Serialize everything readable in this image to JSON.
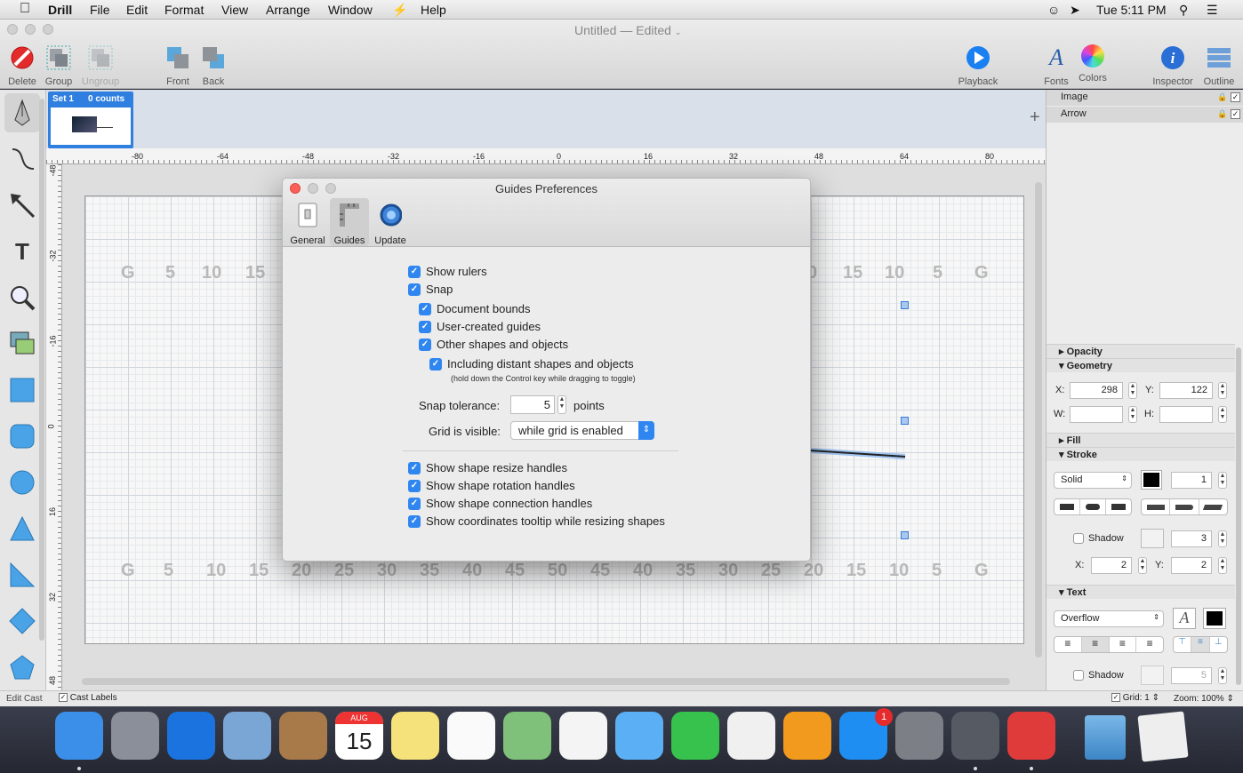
{
  "menubar": {
    "app": "Drill",
    "items": [
      "File",
      "Edit",
      "Format",
      "View",
      "Arrange",
      "Window",
      "Help"
    ],
    "clock": "Tue 5:11 PM"
  },
  "window": {
    "title": "Untitled",
    "subtitle": "— Edited",
    "toolbar_left": [
      {
        "label": "Delete",
        "icon": "delete-icon",
        "enabled": true
      },
      {
        "label": "Group",
        "icon": "group-icon",
        "enabled": true
      },
      {
        "label": "Ungroup",
        "icon": "ungroup-icon",
        "enabled": false
      },
      {
        "label": "Front",
        "icon": "front-icon",
        "enabled": true
      },
      {
        "label": "Back",
        "icon": "back-icon",
        "enabled": true
      }
    ],
    "toolbar_right": [
      {
        "label": "Playback",
        "icon": "playback-icon"
      },
      {
        "label": "Fonts",
        "icon": "fonts-icon"
      },
      {
        "label": "Colors",
        "icon": "colors-icon"
      },
      {
        "label": "Inspector",
        "icon": "inspector-icon"
      },
      {
        "label": "Outline",
        "icon": "outline-icon"
      }
    ]
  },
  "cast": {
    "set_label": "Set 1",
    "counts_label": "0 counts",
    "add_symbol": "+"
  },
  "rulers": {
    "top": [
      "-80",
      "-64",
      "-48",
      "-32",
      "-16",
      "0",
      "16",
      "32",
      "48",
      "64",
      "80"
    ],
    "left": [
      "-48",
      "-32",
      "-16",
      "0",
      "16",
      "32",
      "48"
    ]
  },
  "field_numbers": {
    "top_left": [
      "G",
      "5",
      "10",
      "15"
    ],
    "top_right": [
      "0",
      "15",
      "10",
      "5",
      "G"
    ],
    "bottom": [
      "G",
      "5",
      "10",
      "15",
      "20",
      "25",
      "30",
      "35",
      "40",
      "45",
      "50",
      "45",
      "40",
      "35",
      "30",
      "25",
      "20",
      "15",
      "10",
      "5",
      "G"
    ]
  },
  "layers": [
    {
      "name": "Image"
    },
    {
      "name": "Arrow"
    }
  ],
  "inspector": {
    "opacity": "Opacity",
    "geometry": "Geometry",
    "x_label": "X:",
    "x": "298",
    "y_label": "Y:",
    "y": "122",
    "w_label": "W:",
    "w": "",
    "h_label": "H:",
    "h": "",
    "fill": "Fill",
    "stroke": "Stroke",
    "stroke_style": "Solid",
    "stroke_width": "1",
    "shadow_label": "Shadow",
    "shadow_value": "3",
    "shadow_x_label": "X:",
    "shadow_x": "2",
    "shadow_y_label": "Y:",
    "shadow_y": "2",
    "text": "Text",
    "overflow": "Overflow",
    "text_shadow_label": "Shadow",
    "text_shadow_value": "5"
  },
  "statusbar": {
    "edit_cast": "Edit Cast",
    "cast_labels": "Cast Labels",
    "grid": "Grid: 1",
    "zoom": "Zoom: 100%"
  },
  "dialog": {
    "title": "Guides Preferences",
    "tabs": [
      {
        "label": "General",
        "icon": "general-switch-icon"
      },
      {
        "label": "Guides",
        "icon": "guides-ruler-icon"
      },
      {
        "label": "Update",
        "icon": "update-globe-icon"
      }
    ],
    "options1": [
      {
        "label": "Show rulers",
        "indent": 0
      },
      {
        "label": "Snap",
        "indent": 0
      },
      {
        "label": "Document bounds",
        "indent": 1
      },
      {
        "label": "User-created guides",
        "indent": 1
      },
      {
        "label": "Other shapes and objects",
        "indent": 1
      },
      {
        "label": "Including distant shapes and objects",
        "indent": 2
      }
    ],
    "hint": "(hold down the Control key while dragging to toggle)",
    "snap_tolerance_label": "Snap tolerance:",
    "snap_tolerance_value": "5",
    "snap_units": "points",
    "grid_visible_label": "Grid is visible:",
    "grid_visible_value": "while grid is enabled",
    "options2": [
      {
        "label": "Show shape resize handles"
      },
      {
        "label": "Show shape rotation handles"
      },
      {
        "label": "Show shape connection handles"
      },
      {
        "label": "Show coordinates tooltip while resizing shapes"
      }
    ]
  },
  "dock": [
    {
      "name": "Finder",
      "color": "#3b8fe8"
    },
    {
      "name": "Launchpad",
      "color": "#8a8f99"
    },
    {
      "name": "Safari",
      "color": "#1b73e0"
    },
    {
      "name": "Mail",
      "color": "#7aa6d6"
    },
    {
      "name": "Contacts",
      "color": "#a87a4a"
    },
    {
      "name": "Calendar",
      "color": "#ffffff"
    },
    {
      "name": "Notes",
      "color": "#f6e27a"
    },
    {
      "name": "Reminders",
      "color": "#fafafa"
    },
    {
      "name": "Maps",
      "color": "#7fc07a"
    },
    {
      "name": "Photos",
      "color": "#f4f4f4"
    },
    {
      "name": "Messages",
      "color": "#5bb0f5"
    },
    {
      "name": "FaceTime",
      "color": "#36c24c"
    },
    {
      "name": "iTunes",
      "color": "#f0f0f0"
    },
    {
      "name": "iBooks",
      "color": "#f29a1e"
    },
    {
      "name": "App Store",
      "color": "#1e8ef2"
    },
    {
      "name": "System Preferences",
      "color": "#7c7f86"
    },
    {
      "name": "Drill",
      "color": "#555a63"
    },
    {
      "name": "Gift",
      "color": "#e03b3b"
    }
  ],
  "dock_calendar": {
    "month": "AUG",
    "day": "15"
  },
  "dock_badge": "1"
}
